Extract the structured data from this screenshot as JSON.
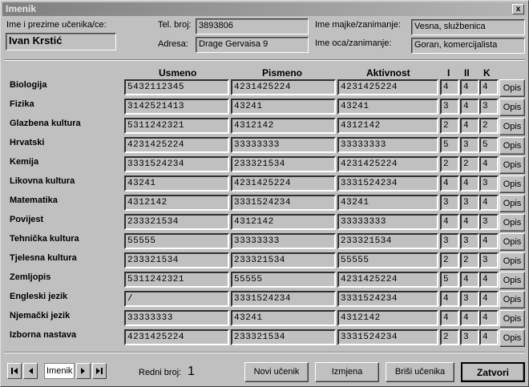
{
  "window": {
    "title": "Imenik",
    "close_glyph": "x"
  },
  "student": {
    "name_label": "Ime i prezime učenika/ce:",
    "name": "Ivan Krstić",
    "phone_label": "Tel. broj:",
    "phone": "3893806",
    "address_label": "Adresa:",
    "address": "Drage Gervaisa 9",
    "mother_label": "Ime majke/zanimanje:",
    "mother": "Vesna, službenica",
    "father_label": "Ime oca/zanimanje:",
    "father": "Goran, komercijalista"
  },
  "columns": {
    "usmeno": "Usmeno",
    "pismeno": "Pismeno",
    "aktivnost": "Aktivnost",
    "i": "I",
    "ii": "II",
    "k": "K"
  },
  "subjects": [
    {
      "name": "Biologija",
      "usmeno": "5432112345",
      "pismeno": "4231425224",
      "aktivnost": "4231425224",
      "i": "4",
      "ii": "4",
      "k": "4",
      "opis": "Opis"
    },
    {
      "name": "Fizika",
      "usmeno": "3142521413",
      "pismeno": "43241",
      "aktivnost": "43241",
      "i": "3",
      "ii": "4",
      "k": "3",
      "opis": "Opis"
    },
    {
      "name": "Glazbena kultura",
      "usmeno": "5311242321",
      "pismeno": "4312142",
      "aktivnost": "4312142",
      "i": "2",
      "ii": "4",
      "k": "2",
      "opis": "Opis"
    },
    {
      "name": "Hrvatski",
      "usmeno": "4231425224",
      "pismeno": "33333333",
      "aktivnost": "33333333",
      "i": "5",
      "ii": "3",
      "k": "5",
      "opis": "Opis"
    },
    {
      "name": "Kemija",
      "usmeno": "3331524234",
      "pismeno": "233321534",
      "aktivnost": "4231425224",
      "i": "2",
      "ii": "2",
      "k": "4",
      "opis": "Opis"
    },
    {
      "name": "Likovna kultura",
      "usmeno": "43241",
      "pismeno": "4231425224",
      "aktivnost": "3331524234",
      "i": "4",
      "ii": "4",
      "k": "3",
      "opis": "Opis"
    },
    {
      "name": "Matematika",
      "usmeno": "4312142",
      "pismeno": "3331524234",
      "aktivnost": "43241",
      "i": "3",
      "ii": "3",
      "k": "4",
      "opis": "Opis"
    },
    {
      "name": "Povijest",
      "usmeno": "233321534",
      "pismeno": "4312142",
      "aktivnost": "33333333",
      "i": "4",
      "ii": "4",
      "k": "3",
      "opis": "Opis"
    },
    {
      "name": "Tehnička kultura",
      "usmeno": "55555",
      "pismeno": "33333333",
      "aktivnost": "233321534",
      "i": "3",
      "ii": "3",
      "k": "4",
      "opis": "Opis"
    },
    {
      "name": "Tjelesna kultura",
      "usmeno": "233321534",
      "pismeno": "233321534",
      "aktivnost": "55555",
      "i": "2",
      "ii": "2",
      "k": "3",
      "opis": "Opis"
    },
    {
      "name": "Zemljopis",
      "usmeno": "5311242321",
      "pismeno": "55555",
      "aktivnost": "4231425224",
      "i": "5",
      "ii": "4",
      "k": "4",
      "opis": "Opis"
    },
    {
      "name": "Engleski jezik",
      "usmeno": "/",
      "pismeno": "3331524234",
      "aktivnost": "3331524234",
      "i": "4",
      "ii": "3",
      "k": "4",
      "opis": "Opis"
    },
    {
      "name": "Njemački jezik",
      "usmeno": "33333333",
      "pismeno": "43241",
      "aktivnost": "4312142",
      "i": "4",
      "ii": "4",
      "k": "4",
      "opis": "Opis"
    },
    {
      "name": "Izborna nastava",
      "usmeno": "4231425224",
      "pismeno": "233321534",
      "aktivnost": "3331524234",
      "i": "2",
      "ii": "3",
      "k": "4",
      "opis": "Opis"
    }
  ],
  "footer": {
    "nav_label": "Imenik",
    "redni_broj_label": "Redni broj:",
    "redni_broj": "1",
    "novi_button": "Novi učenik",
    "izmjena_button": "Izmjena",
    "brisi_button": "Briši učenika",
    "zatvori_button": "Zatvori"
  }
}
